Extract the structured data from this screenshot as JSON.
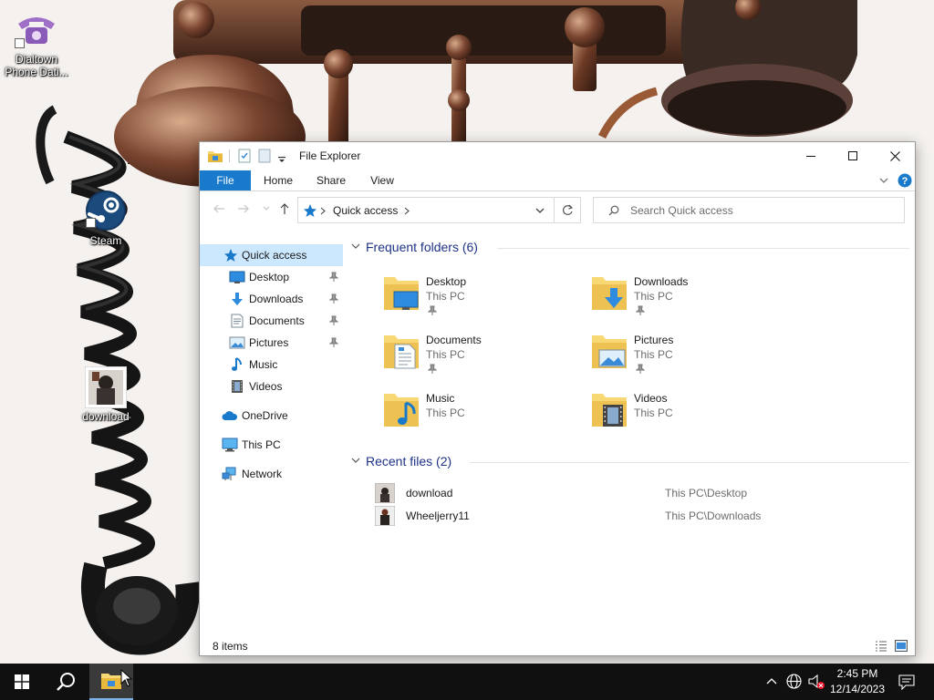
{
  "desktop": {
    "icons": [
      {
        "label": "Dialtown Phone Dati..."
      },
      {
        "label": "Steam"
      },
      {
        "label": "download"
      }
    ]
  },
  "explorer": {
    "title": "File Explorer",
    "ribbon_tabs": [
      "File",
      "Home",
      "Share",
      "View"
    ],
    "address": {
      "location": "Quick access"
    },
    "search": {
      "placeholder": "Search Quick access"
    },
    "nav": {
      "items": [
        {
          "label": "Quick access"
        },
        {
          "label": "Desktop"
        },
        {
          "label": "Downloads"
        },
        {
          "label": "Documents"
        },
        {
          "label": "Pictures"
        },
        {
          "label": "Music"
        },
        {
          "label": "Videos"
        },
        {
          "label": "OneDrive"
        },
        {
          "label": "This PC"
        },
        {
          "label": "Network"
        }
      ]
    },
    "frequent": {
      "heading": "Frequent folders (6)",
      "folders": [
        {
          "name": "Desktop",
          "location": "This PC"
        },
        {
          "name": "Downloads",
          "location": "This PC"
        },
        {
          "name": "Documents",
          "location": "This PC"
        },
        {
          "name": "Pictures",
          "location": "This PC"
        },
        {
          "name": "Music",
          "location": "This PC"
        },
        {
          "name": "Videos",
          "location": "This PC"
        }
      ]
    },
    "recent": {
      "heading": "Recent files (2)",
      "files": [
        {
          "name": "download",
          "path": "This PC\\Desktop"
        },
        {
          "name": "Wheeljerry11",
          "path": "This PC\\Downloads"
        }
      ]
    },
    "status": {
      "item_count": "8 items"
    }
  },
  "taskbar": {
    "clock": {
      "time": "2:45 PM",
      "date": "12/14/2023"
    }
  },
  "colors": {
    "accent": "#1979ca",
    "selection": "#cce8ff",
    "section_heading": "#1e3287",
    "folder_yellow": "#f8d775",
    "taskbar": "#101010"
  }
}
